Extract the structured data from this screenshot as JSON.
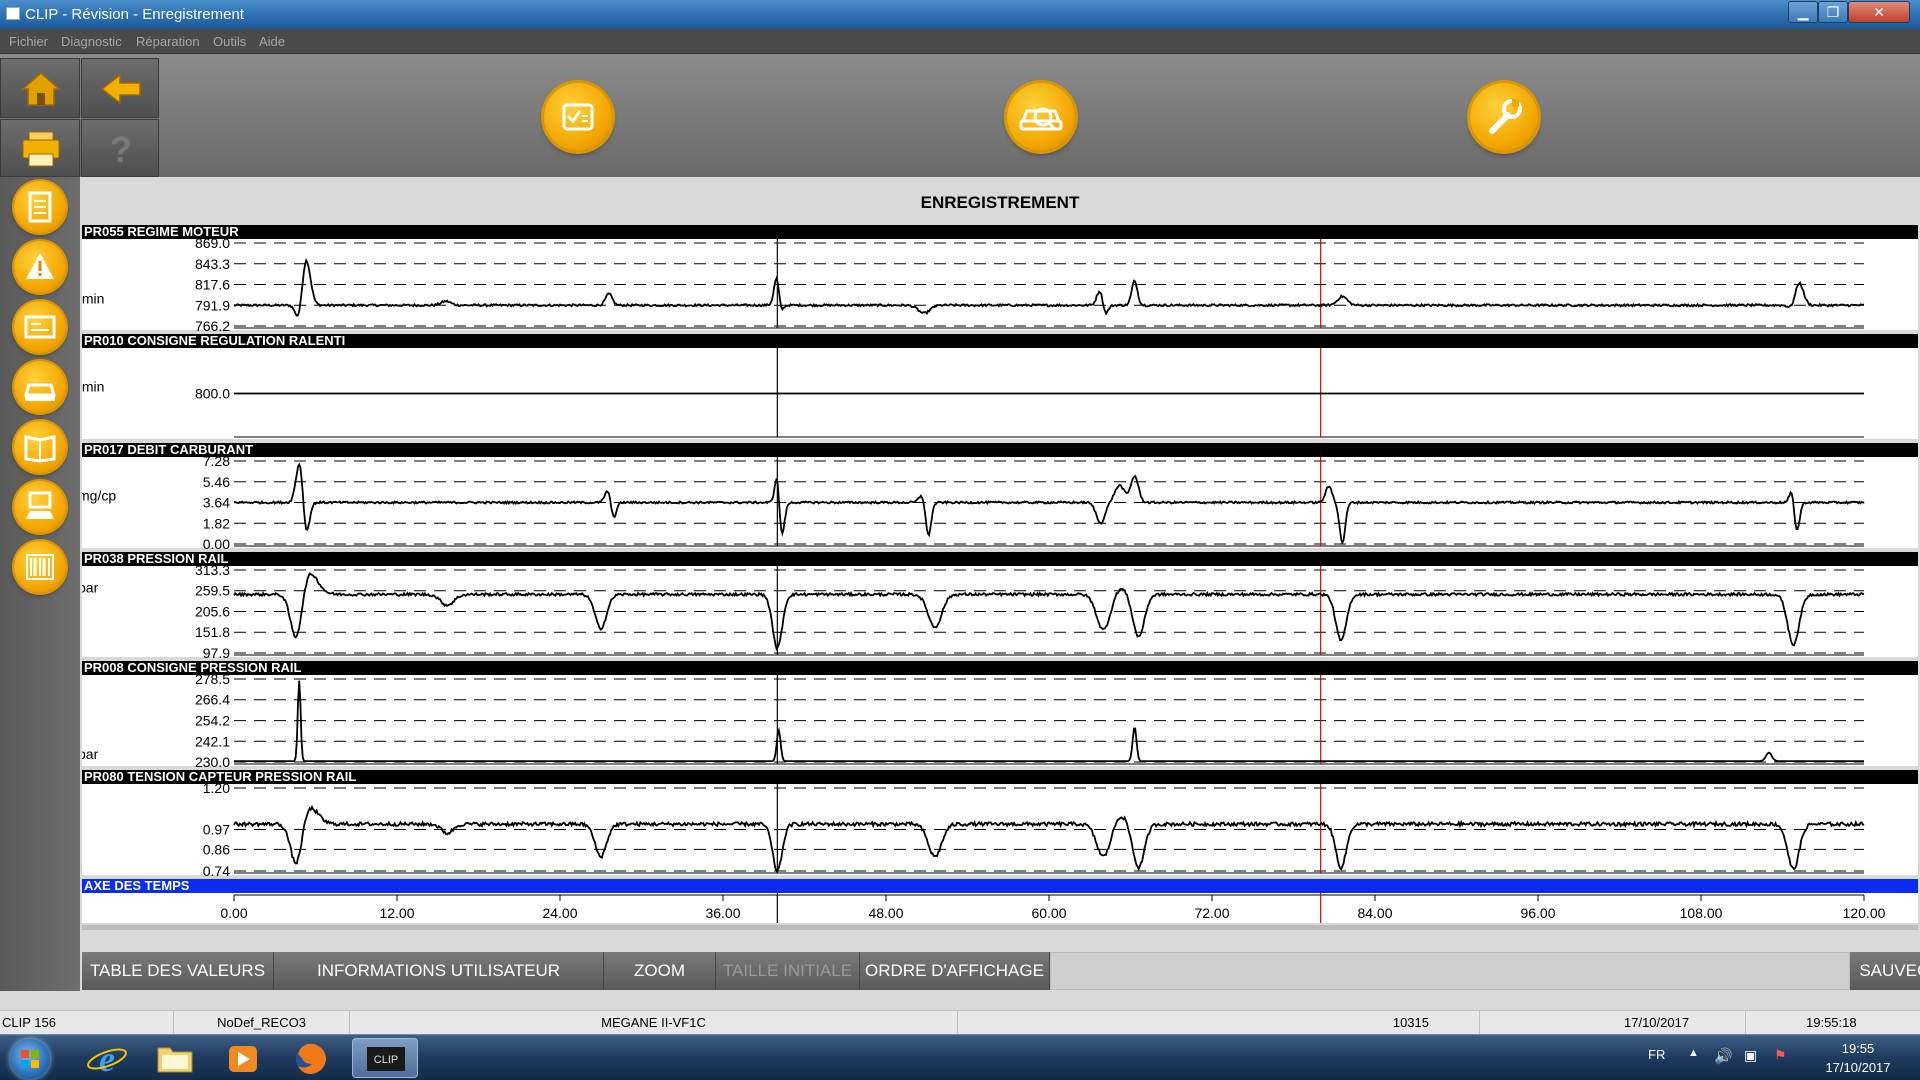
{
  "window": {
    "title": "CLIP - Révision - Enregistrement"
  },
  "menu": {
    "items": [
      "Fichier",
      "Diagnostic",
      "Réparation",
      "Outils",
      "Aide"
    ]
  },
  "toolbar": {
    "icons": [
      "home-icon",
      "back-arrow-icon",
      "print-icon",
      "help-icon"
    ],
    "orbs": [
      "checklist-icon",
      "vehicle-diagnostic-icon",
      "wrench-icon"
    ]
  },
  "sidebar": {
    "icons": [
      "document-icon",
      "warning-icon",
      "ecu-icon",
      "vehicle-icon",
      "manual-icon",
      "test-tool-icon",
      "barcode-icon"
    ]
  },
  "page": {
    "title": "ENREGISTREMENT"
  },
  "chart_data": {
    "type": "line",
    "x_axis": {
      "label": "AXE DES TEMPS",
      "ticks": [
        "0.00",
        "12.00",
        "24.00",
        "36.00",
        "48.00",
        "60.00",
        "72.00",
        "84.00",
        "96.00",
        "108.00",
        "120.00"
      ],
      "range": [
        0,
        120
      ],
      "cursors": [
        {
          "x": 40.0,
          "color": "#000000"
        },
        {
          "x": 80.0,
          "color": "#e00000"
        }
      ]
    },
    "panels": [
      {
        "id": "PR055",
        "name": "REGIME MOTEUR",
        "unit": "/min",
        "yticks": [
          "869.0",
          "843.3",
          "817.6",
          "791.9",
          "766.2"
        ],
        "range": [
          766.2,
          869.0
        ],
        "baseline": 791.9,
        "noise": 1.3,
        "events": [
          [
            4.8,
            -24,
            0.35
          ],
          [
            5.3,
            58,
            0.45
          ],
          [
            15.6,
            5,
            0.5
          ],
          [
            27.6,
            14,
            0.35
          ],
          [
            40.0,
            42,
            0.3
          ],
          [
            40.2,
            -22,
            0.25
          ],
          [
            50.8,
            -10,
            0.6
          ],
          [
            63.8,
            22,
            0.35
          ],
          [
            64.1,
            -17,
            0.3
          ],
          [
            66.3,
            30,
            0.3
          ],
          [
            81.6,
            11,
            0.5
          ],
          [
            114.8,
            -8,
            0.4
          ],
          [
            115.2,
            30,
            0.45
          ]
        ]
      },
      {
        "id": "PR010",
        "name": "CONSIGNE REGULATION RALENTI",
        "unit": "/min",
        "yticks": [
          "800.0"
        ],
        "range": [
          760.0,
          840.0
        ],
        "baseline": 800.0,
        "noise": 0,
        "events": []
      },
      {
        "id": "PR017",
        "name": "DEBIT CARBURANT",
        "unit": "mg/cp",
        "yticks": [
          "7.28",
          "5.46",
          "3.64",
          "1.82",
          "0.00"
        ],
        "range": [
          0.0,
          7.28
        ],
        "baseline": 3.64,
        "noise": 0.09,
        "events": [
          [
            4.6,
            1.2,
            0.3
          ],
          [
            4.9,
            3.3,
            0.3
          ],
          [
            5.3,
            -2.8,
            0.35
          ],
          [
            27.6,
            1.4,
            0.35
          ],
          [
            27.9,
            -1.8,
            0.3
          ],
          [
            40.0,
            3.0,
            0.25
          ],
          [
            40.3,
            -3.2,
            0.3
          ],
          [
            50.8,
            1.0,
            0.4
          ],
          [
            51.1,
            -3.4,
            0.3
          ],
          [
            63.8,
            -1.8,
            0.45
          ],
          [
            65.2,
            1.5,
            0.5
          ],
          [
            66.3,
            2.3,
            0.4
          ],
          [
            80.6,
            1.4,
            0.35
          ],
          [
            81.6,
            -3.5,
            0.3
          ],
          [
            114.8,
            2.2,
            0.3
          ],
          [
            115.0,
            -3.6,
            0.3
          ]
        ]
      },
      {
        "id": "PR038",
        "name": "PRESSION RAIL",
        "unit": "bar",
        "yticks": [
          "313.3",
          "259.5",
          "205.6",
          "151.8",
          "97.9"
        ],
        "range": [
          97.9,
          313.3
        ],
        "baseline": 250.0,
        "noise": 3.5,
        "events": [
          [
            4.6,
            -130,
            0.6
          ],
          [
            5.5,
            60,
            0.9
          ],
          [
            15.7,
            -28,
            0.7
          ],
          [
            27.0,
            -88,
            0.6
          ],
          [
            40.0,
            -140,
            0.5
          ],
          [
            51.6,
            -85,
            0.7
          ],
          [
            64.0,
            -92,
            0.7
          ],
          [
            65.3,
            18,
            0.6
          ],
          [
            66.6,
            -110,
            0.6
          ],
          [
            81.5,
            -120,
            0.55
          ],
          [
            114.8,
            -130,
            0.6
          ]
        ]
      },
      {
        "id": "PR008",
        "name": "CONSIGNE PRESSION RAIL",
        "unit": "bar",
        "yticks": [
          "278.5",
          "266.4",
          "254.2",
          "242.1",
          "230.0"
        ],
        "range": [
          230.0,
          278.5
        ],
        "baseline": 230.5,
        "noise": 0,
        "events": [
          [
            4.8,
            47,
            0.15
          ],
          [
            40.1,
            18,
            0.2
          ],
          [
            66.3,
            20,
            0.2
          ],
          [
            113.0,
            5,
            0.3
          ]
        ]
      },
      {
        "id": "PR080",
        "name": "TENSION CAPTEUR PRESSION RAIL",
        "unit": "",
        "yticks": [
          "1.20",
          "0.97",
          "0.86",
          "0.74"
        ],
        "range": [
          0.74,
          1.2
        ],
        "baseline": 1.0,
        "noise": 0.01,
        "events": [
          [
            4.6,
            -0.25,
            0.6
          ],
          [
            5.5,
            0.1,
            0.9
          ],
          [
            15.7,
            -0.05,
            0.6
          ],
          [
            27.0,
            -0.18,
            0.6
          ],
          [
            40.0,
            -0.26,
            0.5
          ],
          [
            51.6,
            -0.18,
            0.7
          ],
          [
            64.0,
            -0.18,
            0.7
          ],
          [
            65.3,
            0.05,
            0.6
          ],
          [
            66.6,
            -0.24,
            0.6
          ],
          [
            81.5,
            -0.24,
            0.55
          ],
          [
            114.8,
            -0.25,
            0.6
          ]
        ]
      }
    ]
  },
  "buttons": {
    "table": "TABLE DES VALEURS",
    "info": "INFORMATIONS UTILISATEUR",
    "zoom": "ZOOM",
    "reset": "TAILLE INITIALE",
    "order": "ORDRE D'AFFICHAGE",
    "save": "SAUVEGARDER"
  },
  "status": {
    "clip": "CLIP 156",
    "nodef": "NoDef_RECO3",
    "vehicle": "MEGANE II-VF1C",
    "code": "10315",
    "date": "17/10/2017",
    "time": "19:55:18"
  },
  "taskbar": {
    "apps": [
      "internet-explorer-icon",
      "folder-icon",
      "media-player-icon",
      "firefox-icon",
      "clip-app-icon"
    ],
    "lang": "FR",
    "clock_time": "19:55",
    "clock_date": "17/10/2017"
  }
}
